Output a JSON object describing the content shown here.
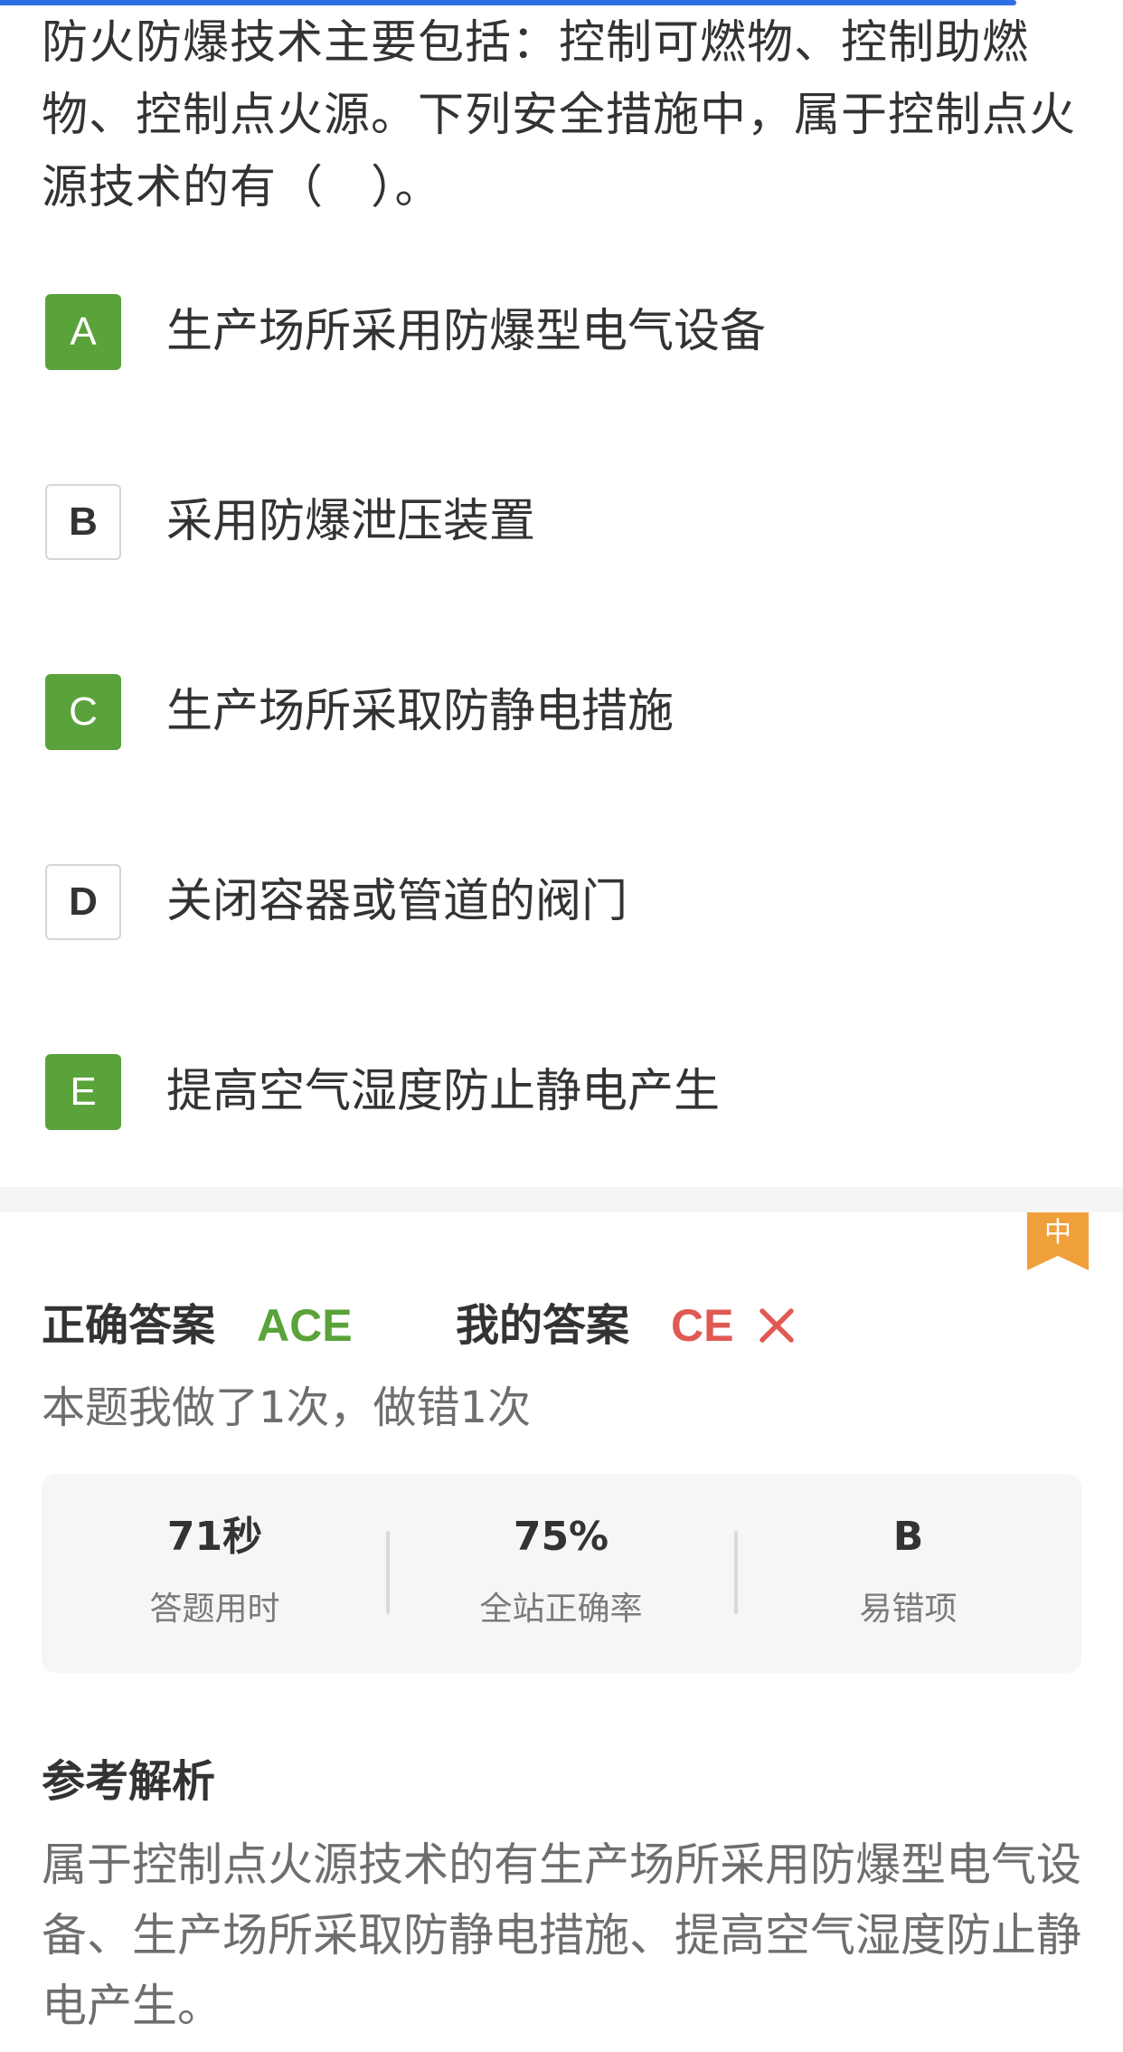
{
  "question": {
    "text": "防火防爆技术主要包括：控制可燃物、控制助燃物、控制点火源。下列安全措施中，属于控制点火源技术的有（　）。"
  },
  "options": [
    {
      "letter": "A",
      "text": "生产场所采用防爆型电气设备",
      "selected": true
    },
    {
      "letter": "B",
      "text": "采用防爆泄压装置",
      "selected": false
    },
    {
      "letter": "C",
      "text": "生产场所采取防静电措施",
      "selected": true
    },
    {
      "letter": "D",
      "text": "关闭容器或管道的阀门",
      "selected": false
    },
    {
      "letter": "E",
      "text": "提高空气湿度防止静电产生",
      "selected": true
    }
  ],
  "difficulty": {
    "label": "中",
    "color": "#f0a03a"
  },
  "answer": {
    "correct_label": "正确答案",
    "correct_value": "ACE",
    "mine_label": "我的答案",
    "mine_value": "CE",
    "result_icon": "close-icon"
  },
  "history": "本题我做了1次，做错1次",
  "stats": [
    {
      "value": "71秒",
      "caption": "答题用时"
    },
    {
      "value": "75%",
      "caption": "全站正确率"
    },
    {
      "value": "B",
      "caption": "易错项"
    }
  ],
  "analysis": {
    "title": "参考解析",
    "body": "属于控制点火源技术的有生产场所采用防爆型电气设备、生产场所采取防静电措施、提高空气湿度防止静电产生。"
  },
  "colors": {
    "correct": "#5aa23a",
    "wrong": "#e05a54",
    "progress": "#2f6fe4",
    "tag": "#f0a03a"
  }
}
